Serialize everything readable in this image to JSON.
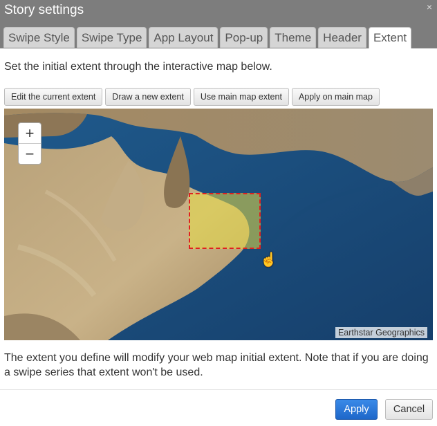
{
  "dialog": {
    "title": "Story settings",
    "close_icon": "×"
  },
  "tabs": [
    {
      "label": "Swipe Style"
    },
    {
      "label": "Swipe Type"
    },
    {
      "label": "App Layout"
    },
    {
      "label": "Pop-up"
    },
    {
      "label": "Theme"
    },
    {
      "label": "Header"
    },
    {
      "label": "Extent",
      "active": true
    }
  ],
  "extent_panel": {
    "intro": "Set the initial extent through the interactive map below.",
    "buttons": {
      "edit": "Edit the current extent",
      "draw": "Draw a new extent",
      "use_main": "Use main map extent",
      "apply_main": "Apply on main map"
    },
    "map": {
      "zoom_in": "+",
      "zoom_out": "−",
      "attribution": "Earthstar Geographics"
    },
    "note": "The extent you define will modify your web map initial extent. Note that if you are doing a swipe series that extent won't be used."
  },
  "footer": {
    "apply": "Apply",
    "cancel": "Cancel"
  },
  "colors": {
    "titlebar": "#7d7d7d",
    "primary_button": "#1e67c9",
    "extent_border": "#e02020",
    "extent_fill": "#e6dc46"
  }
}
